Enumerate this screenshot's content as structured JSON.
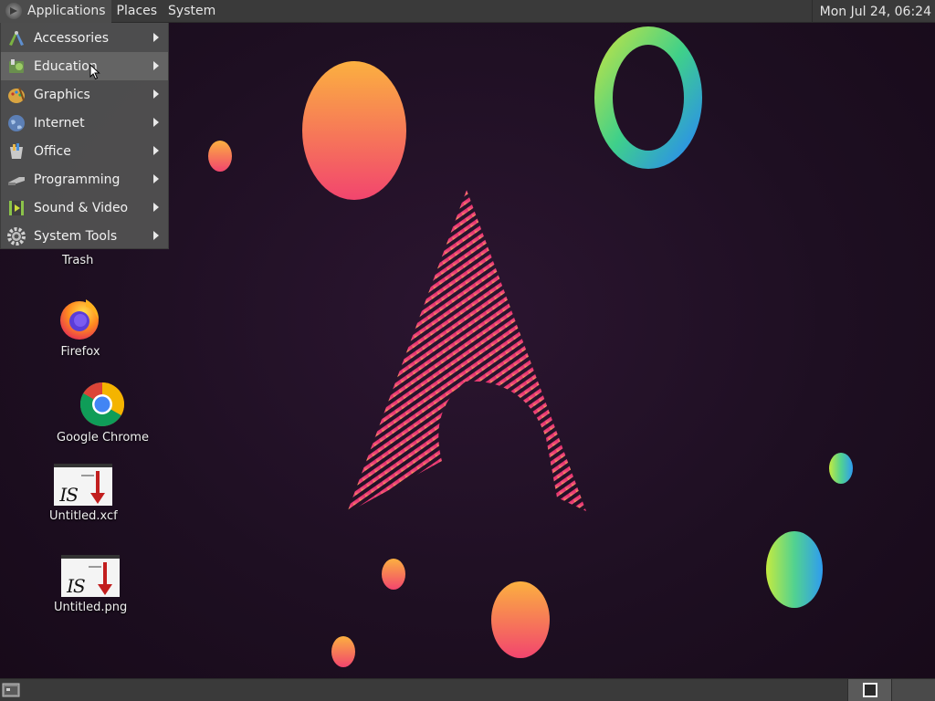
{
  "top_panel": {
    "menus": [
      {
        "label": "Applications",
        "active": true
      },
      {
        "label": "Places",
        "active": false
      },
      {
        "label": "System",
        "active": false
      }
    ],
    "clock": "Mon Jul 24, 06:24"
  },
  "apps_menu": {
    "items": [
      {
        "label": "Accessories",
        "icon": "accessories-icon"
      },
      {
        "label": "Education",
        "icon": "education-icon",
        "hovered": true
      },
      {
        "label": "Graphics",
        "icon": "graphics-icon"
      },
      {
        "label": "Internet",
        "icon": "internet-globe-icon"
      },
      {
        "label": "Office",
        "icon": "office-icon"
      },
      {
        "label": "Programming",
        "icon": "programming-icon"
      },
      {
        "label": "Sound & Video",
        "icon": "sound-video-icon"
      },
      {
        "label": "System Tools",
        "icon": "system-tools-gear-icon"
      }
    ]
  },
  "desktop": {
    "icons": [
      {
        "label": "Trash",
        "icon": "trash-icon"
      },
      {
        "label": "Firefox",
        "icon": "firefox-icon"
      },
      {
        "label": "Google Chrome",
        "icon": "chrome-icon"
      },
      {
        "label": "Untitled.xcf",
        "icon": "image-thumbnail-icon"
      },
      {
        "label": "Untitled.png",
        "icon": "image-thumbnail-icon"
      }
    ],
    "thumb_text": "IS"
  },
  "colors": {
    "panel_bg": "#3a3a3a",
    "menu_bg": "#505050",
    "wallpaper_bg": "#1e0f22",
    "accent_pink": "#e0286e",
    "accent_orange": "#f7a03c"
  }
}
